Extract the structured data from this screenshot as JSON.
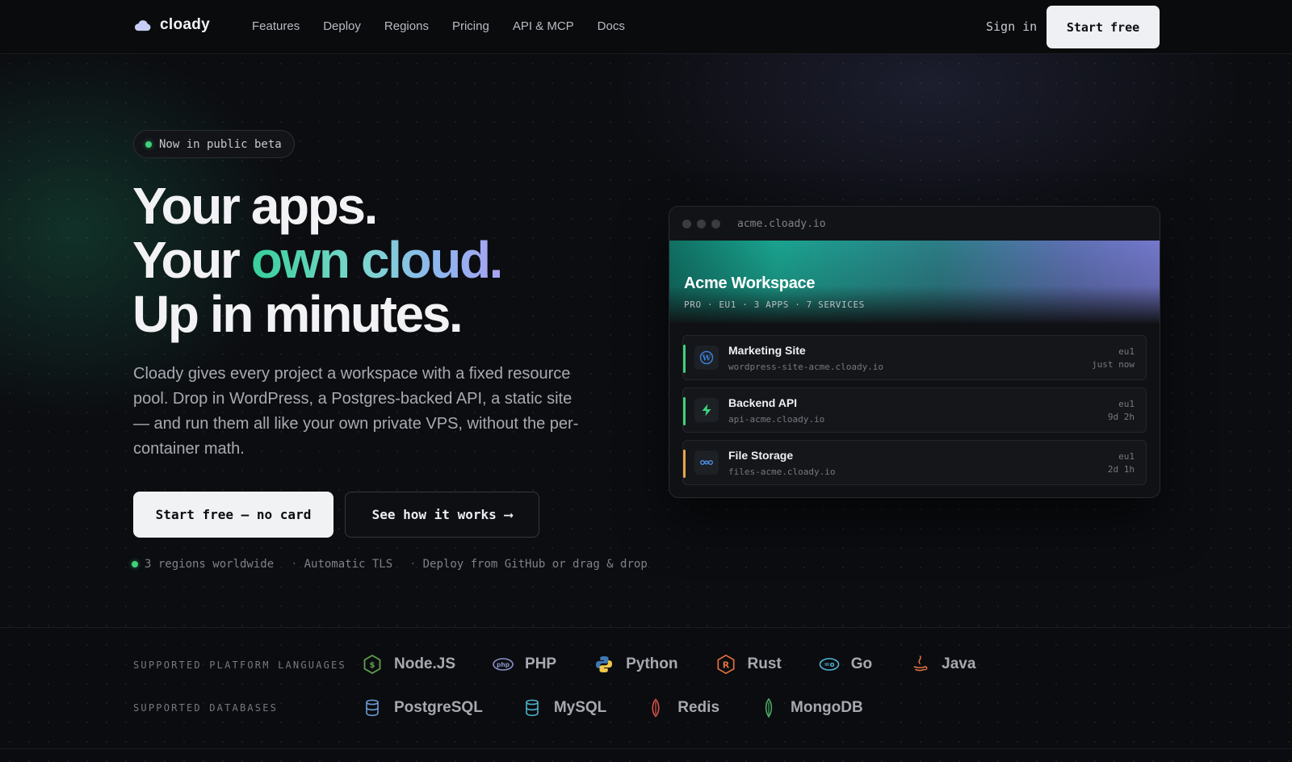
{
  "brand": {
    "name": "cloady"
  },
  "nav": {
    "links": [
      "Features",
      "Deploy",
      "Regions",
      "Pricing",
      "API & MCP",
      "Docs"
    ],
    "sign_in": "Sign in",
    "start": "Start free"
  },
  "hero": {
    "badge": "Now in public beta",
    "line1": "Your apps.",
    "line2_prefix": "Your ",
    "line2_gradient": "own cloud.",
    "line3": "Up in minutes.",
    "lede": "Cloady gives every project a workspace with a fixed resource pool. Drop in WordPress, a Postgres-backed API, a static site — and run them all like your own private VPS, without the per-container math.",
    "cta_primary": "Start free — no card",
    "cta_secondary": "See how it works",
    "cta_arrow": "⟶",
    "facts": [
      "3 regions worldwide",
      "Automatic TLS",
      "Deploy from GitHub or drag & drop"
    ],
    "fact_separator": "·"
  },
  "workspace": {
    "url": "acme.cloady.io",
    "title": "Acme Workspace",
    "meta": "PRO · EU1 · 3 APPS · 7 SERVICES",
    "apps": [
      {
        "name": "Marketing Site",
        "host": "wordpress-site-acme.cloady.io",
        "region": "eu1",
        "time": "just now",
        "accent": "#3fd17d",
        "icon": "wordpress-icon"
      },
      {
        "name": "Backend API",
        "host": "api-acme.cloady.io",
        "region": "eu1",
        "time": "9d 2h",
        "accent": "#3fd17d",
        "icon": "lightning-icon"
      },
      {
        "name": "File Storage",
        "host": "files-acme.cloady.io",
        "region": "eu1",
        "time": "2d 1h",
        "accent": "#e7a34a",
        "icon": "storage-icon"
      }
    ]
  },
  "supported": {
    "languages_label": "SUPPORTED PLATFORM LANGUAGES",
    "languages": [
      {
        "name": "Node.JS",
        "icon": "nodejs-icon"
      },
      {
        "name": "PHP",
        "icon": "php-icon"
      },
      {
        "name": "Python",
        "icon": "python-icon"
      },
      {
        "name": "Rust",
        "icon": "rust-icon"
      },
      {
        "name": "Go",
        "icon": "go-icon"
      },
      {
        "name": "Java",
        "icon": "java-icon"
      }
    ],
    "databases_label": "SUPPORTED DATABASES",
    "databases": [
      {
        "name": "PostgreSQL",
        "icon": "postgresql-icon"
      },
      {
        "name": "MySQL",
        "icon": "mysql-icon"
      },
      {
        "name": "Redis",
        "icon": "redis-icon"
      },
      {
        "name": "MongoDB",
        "icon": "mongodb-icon"
      }
    ]
  },
  "colors": {
    "background": "#0b0c0f",
    "accent_green": "#3fd17d",
    "accent_orange": "#e7a34a",
    "button_light": "#f1f2f4"
  }
}
